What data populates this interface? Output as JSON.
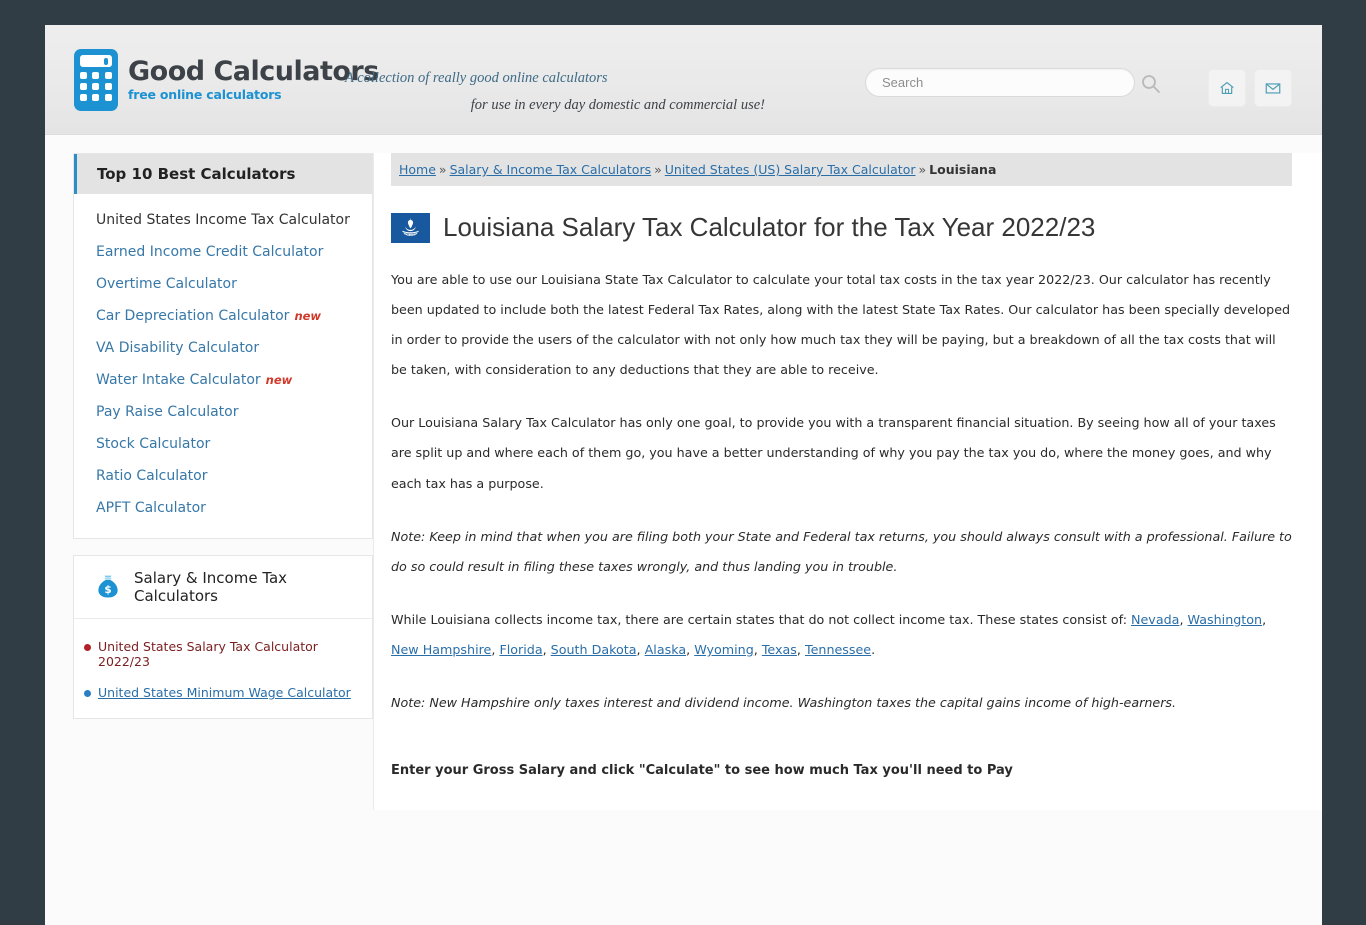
{
  "header": {
    "logo_title": "Good Calculators",
    "logo_sub": "free online calculators",
    "tagline_line1": "A collection of really good online calculators",
    "tagline_line2": "for use in every day domestic and commercial use!",
    "search_placeholder": "Search",
    "search_value": "",
    "home_icon": "home-icon",
    "mail_icon": "mail-icon",
    "search_icon": "search-icon"
  },
  "sidebar": {
    "top10_heading": "Top 10 Best Calculators",
    "top10_items": [
      {
        "label": "United States Income Tax Calculator",
        "current": true,
        "badge": ""
      },
      {
        "label": "Earned Income Credit Calculator",
        "current": false,
        "badge": ""
      },
      {
        "label": "Overtime Calculator",
        "current": false,
        "badge": ""
      },
      {
        "label": "Car Depreciation Calculator",
        "current": false,
        "badge": "new"
      },
      {
        "label": "VA Disability Calculator",
        "current": false,
        "badge": ""
      },
      {
        "label": "Water Intake Calculator",
        "current": false,
        "badge": "new"
      },
      {
        "label": "Pay Raise Calculator",
        "current": false,
        "badge": ""
      },
      {
        "label": "Stock Calculator",
        "current": false,
        "badge": ""
      },
      {
        "label": "Ratio Calculator",
        "current": false,
        "badge": ""
      },
      {
        "label": "APFT Calculator",
        "current": false,
        "badge": ""
      }
    ],
    "salary_heading": "Salary & Income Tax Calculators",
    "salary_icon": "money-bag-icon",
    "salary_items": [
      {
        "label": "United States Salary Tax Calculator 2022/23",
        "current": true,
        "dot_color": "#b31f27"
      },
      {
        "label": "United States Minimum Wage Calculator",
        "current": false,
        "dot_color": "#2a7fc4"
      }
    ]
  },
  "breadcrumb": {
    "items": [
      {
        "label": "Home",
        "link": true
      },
      {
        "label": "Salary & Income Tax Calculators",
        "link": true
      },
      {
        "label": "United States (US) Salary Tax Calculator",
        "link": true
      },
      {
        "label": "Louisiana",
        "link": false
      }
    ],
    "separator": "»"
  },
  "main": {
    "flag_icon": "louisiana-flag-icon",
    "title": "Louisiana Salary Tax Calculator for the Tax Year 2022/23",
    "paragraph_1": "You are able to use our Louisiana State Tax Calculator to calculate your total tax costs in the tax year 2022/23. Our calculator has recently been updated to include both the latest Federal Tax Rates, along with the latest State Tax Rates. Our calculator has been specially developed in order to provide the users of the calculator with not only how much tax they will be paying, but a breakdown of all the tax costs that will be taken, with consideration to any deductions that they are able to receive.",
    "paragraph_2": "Our Louisiana Salary Tax Calculator has only one goal, to provide you with a transparent financial situation. By seeing how all of your taxes are split up and where each of them go, you have a better understanding of why you pay the tax you do, where the money goes, and why each tax has a purpose.",
    "paragraph_3_note": "Note: Keep in mind that when you are filing both your State and Federal tax returns, you should always consult with a professional. Failure to do so could result in filing these taxes wrongly, and thus landing you in trouble.",
    "paragraph_4_prefix": "While Louisiana collects income tax, there are certain states that do not collect income tax. These states consist of: ",
    "no_tax_states": [
      "Nevada",
      "Washington",
      "New Hampshire",
      "Florida",
      "South Dakota",
      "Alaska",
      "Wyoming",
      "Texas",
      "Tennessee"
    ],
    "paragraph_5_note": "Note: New Hampshire only taxes interest and dividend income. Washington taxes the capital gains income of high-earners.",
    "cta_text": "Enter your Gross Salary and click \"Calculate\" to see how much Tax you'll need to Pay"
  },
  "colors": {
    "page_bg": "#313d44",
    "brand_blue": "#1c92d2",
    "link_blue": "#2a6ea8",
    "accent_bar": "#2b8fc4",
    "new_badge": "#d1392b"
  }
}
